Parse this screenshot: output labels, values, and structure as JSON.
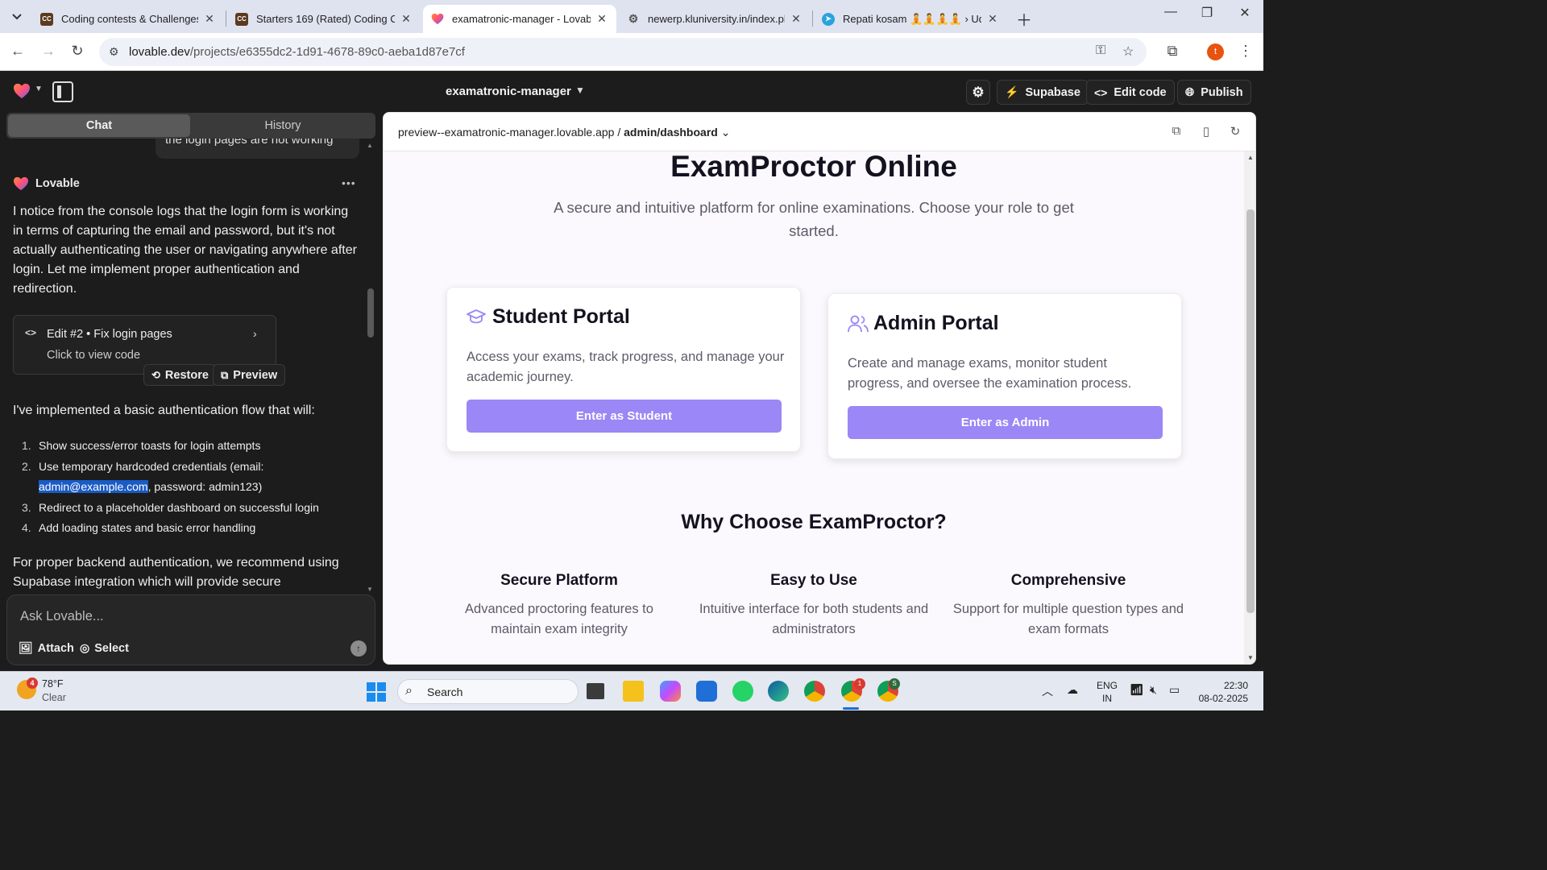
{
  "browser": {
    "tabs": [
      {
        "title": "Coding contests & Challenges",
        "favicon": "codechef-icon"
      },
      {
        "title": "Starters 169 (Rated) Coding Co",
        "favicon": "codechef-icon"
      },
      {
        "title": "examatronic-manager - Lovable",
        "favicon": "lovable-heart-icon"
      },
      {
        "title": "newerp.kluniversity.in/index.ph",
        "favicon": "gear-icon"
      },
      {
        "title": "Repati kosam 🧘🧘🧘🧘 › Ud",
        "favicon": "telegram-icon"
      }
    ],
    "url_domain": "lovable.dev",
    "url_path": "/projects/e6355dc2-1d91-4678-89c0-aeba1d87e7cf",
    "profile_initial": "t"
  },
  "app": {
    "project_name": "examatronic-manager",
    "buttons": {
      "supabase": "Supabase",
      "edit_code": "Edit code",
      "publish": "Publish"
    }
  },
  "chat": {
    "tabs": {
      "chat": "Chat",
      "history": "History"
    },
    "previous_user_message": "the login pages are not working",
    "author": "Lovable",
    "message_1": "I notice from the console logs that the login form is working in terms of capturing the email and password, but it's not actually authenticating the user or navigating anywhere after login. Let me implement proper authentication and redirection.",
    "edit_card": {
      "title": "Edit #2 • Fix login pages",
      "subtitle": "Click to view code"
    },
    "actions": {
      "restore": "Restore",
      "preview": "Preview"
    },
    "message_2": "I've implemented a basic authentication flow that will:",
    "list": {
      "item1": "Show success/error toasts for login attempts",
      "item2_before": "Use temporary hardcoded credentials (email: ",
      "item2_highlight": "admin@example.com",
      "item2_after": ", password: admin123)",
      "item3": "Redirect to a placeholder dashboard on successful login",
      "item4": "Add loading states and basic error handling",
      "n1": "1.",
      "n2": "2.",
      "n3": "3.",
      "n4": "4."
    },
    "message_3": "For proper backend authentication, we recommend using Supabase integration which will provide secure",
    "composer": {
      "placeholder": "Ask Lovable...",
      "attach": "Attach",
      "select": "Select"
    }
  },
  "preview": {
    "url_host": "preview--examatronic-manager.lovable.app",
    "url_sep": " / ",
    "url_path": "admin/dashboard",
    "hero_title": "ExamProctor Online",
    "hero_subtitle": "A secure and intuitive platform for online examinations. Choose your role to get started.",
    "student": {
      "title": "Student Portal",
      "description": "Access your exams, track progress, and manage your academic journey.",
      "button": "Enter as Student"
    },
    "admin": {
      "title": "Admin Portal",
      "description": "Create and manage exams, monitor student progress, and oversee the examination process.",
      "button": "Enter as Admin"
    },
    "why_title": "Why Choose ExamProctor?",
    "features": [
      {
        "title": "Secure Platform",
        "description": "Advanced proctoring features to maintain exam integrity"
      },
      {
        "title": "Easy to Use",
        "description": "Intuitive interface for both students and administrators"
      },
      {
        "title": "Comprehensive",
        "description": "Support for multiple question types and exam formats"
      }
    ],
    "accent_color": "#9b87f5"
  },
  "taskbar": {
    "weather_temp": "78°F",
    "weather_state": "Clear",
    "weather_badge": "4",
    "search_label": "Search",
    "lang_1": "ENG",
    "lang_2": "IN",
    "time": "22:30",
    "date": "08-02-2025",
    "chrome_badge_1": "1",
    "chrome_badge_2": "S"
  }
}
